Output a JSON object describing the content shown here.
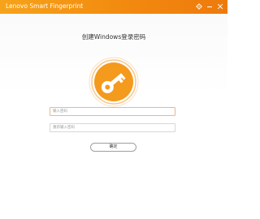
{
  "window": {
    "title": "Lenovo Smart Fingerprint"
  },
  "titlebar_buttons": {
    "settings_icon": "gear-icon",
    "minimize_icon": "minimize-icon",
    "close_icon": "close-icon"
  },
  "main": {
    "heading": "创建Windows登录密码",
    "badge_icon": "key-icon",
    "password_field": {
      "placeholder": "输入密码",
      "value": ""
    },
    "confirm_password_field": {
      "placeholder": "重新输入密码",
      "value": ""
    },
    "confirm_button_label": "确定"
  },
  "colors": {
    "accent": "#f28a0f",
    "accent_light": "#f6a31a",
    "badge_ring": "#f9c78a"
  }
}
